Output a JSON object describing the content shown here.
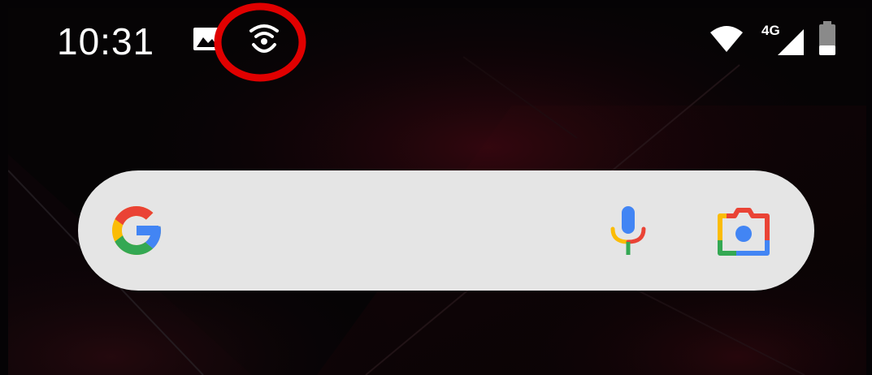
{
  "status_bar": {
    "time": "10:31",
    "network_type": "4G",
    "icons": [
      "gallery-icon",
      "hotspot-icon",
      "wifi-icon",
      "cellular-signal-icon",
      "battery-icon"
    ],
    "highlighted_icon": "hotspot-icon"
  },
  "search_widget": {
    "logo": "google-logo",
    "actions": [
      "mic-icon",
      "lens-icon"
    ]
  },
  "colors": {
    "google_blue": "#4285F4",
    "google_red": "#EA4335",
    "google_yellow": "#FBBC05",
    "google_green": "#34A853",
    "highlight_ring": "#E00000",
    "search_bar_bg": "#E5E5E5"
  }
}
